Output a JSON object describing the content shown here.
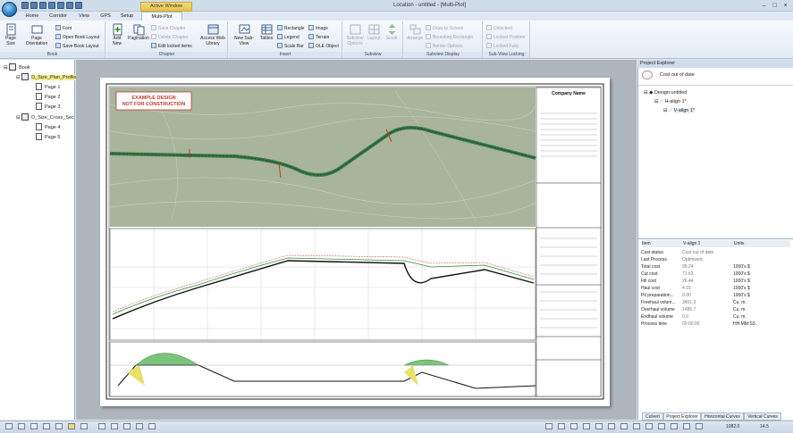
{
  "window": {
    "title": "Location - untitled - [Multi-Plot]",
    "context_tab": "Active Window"
  },
  "tabs": [
    {
      "label": "Home"
    },
    {
      "label": "Corridor"
    },
    {
      "label": "View"
    },
    {
      "label": "GPS"
    },
    {
      "label": "Setup"
    },
    {
      "label": "Multi-Plot"
    }
  ],
  "ribbon": {
    "book": {
      "label": "Book",
      "page_size": "Page Size",
      "page_orientation": "Page Orientation",
      "font": "Font",
      "open_layout": "Open Book Layout",
      "save_layout": "Save Book Layout"
    },
    "chapter": {
      "label": "Chapter",
      "add_new": "Add New",
      "pagination": "Pagination",
      "save_chapter": "Save Chapter",
      "delete_chapter": "Delete Chapter",
      "edit_locked": "Edit locked items",
      "access_web": "Access Web Library"
    },
    "insert": {
      "label": "Insert",
      "new_subview": "New Sub-View",
      "tables": "Tables",
      "rectangle": "Rectangle",
      "legend": "Legend",
      "scale_bar": "Scale Bar",
      "image": "Image",
      "terrain": "Terrain",
      "ole_object": "OLE Object"
    },
    "subview": {
      "label": "Subview",
      "options": "Subview Options",
      "layout": "Layout",
      "scroll": "Scroll"
    },
    "subview_display": {
      "label": "Subview Display",
      "arrange": "Arrange",
      "draw_to_screen": "Draw to Screen",
      "bounding_rect": "Bounding Rectangle",
      "border_options": "Border Options"
    },
    "subview_locking": {
      "label": "Sub-View Locking",
      "unlocked": "Unlocked",
      "locked_position": "Locked Position",
      "locked_fully": "Locked Fully"
    }
  },
  "book_tree": {
    "root": "Book",
    "chapters": [
      {
        "name": "D_Size_Plan_Profile",
        "pages": [
          "Page 1",
          "Page 2",
          "Page 3"
        ]
      },
      {
        "name": "D_Size_Cross_Sec",
        "pages": [
          "Page 4",
          "Page 5"
        ]
      }
    ]
  },
  "sheet": {
    "stamp_line1": "EXAMPLE DESIGN",
    "stamp_line2": "NOT FOR CONSTRUCTION",
    "company": "Company Name"
  },
  "project_explorer": {
    "header": "Project Explorer",
    "status": "Cost out of date",
    "tree": [
      "Design:untitled",
      "H-align 1*",
      "V-align 1*"
    ],
    "props_header": {
      "item": "Item",
      "value": "V-align 1",
      "units": "Units"
    },
    "props": [
      {
        "name": "Cost status",
        "value": "Cost out of date",
        "units": ""
      },
      {
        "name": "Last Process",
        "value": "Optimized",
        "units": ""
      },
      {
        "name": "Total cost",
        "value": "95.24",
        "units": "1000's $"
      },
      {
        "name": "Cut cost",
        "value": "71.63",
        "units": "1000's $"
      },
      {
        "name": "Fill cost",
        "value": "26.44",
        "units": "1000's $"
      },
      {
        "name": "Haul cost",
        "value": "4.15",
        "units": "1000's $"
      },
      {
        "name": "Pit preparation...",
        "value": "0.00",
        "units": "1000's $"
      },
      {
        "name": "Freehaul volum...",
        "value": "3451.3",
        "units": "Cu. m."
      },
      {
        "name": "Overhaul volume",
        "value": "1485.7",
        "units": "Cu. m."
      },
      {
        "name": "Endhaul volume",
        "value": "0.0",
        "units": "Cu. m."
      },
      {
        "name": "Process time",
        "value": "00:00:00",
        "units": "HH:MM:SS"
      }
    ],
    "bottom_tabs": [
      "Culvert",
      "Project Explorer",
      "Horizontal Curves",
      "Vertical Curves"
    ]
  },
  "status": {
    "v1": "1082.0",
    "v2": "14.5"
  },
  "colors": {
    "accent": "#2a63a6",
    "map_bg": "#a9b59c",
    "road_green": "#2f8a2f",
    "road_red": "#c0392b"
  }
}
